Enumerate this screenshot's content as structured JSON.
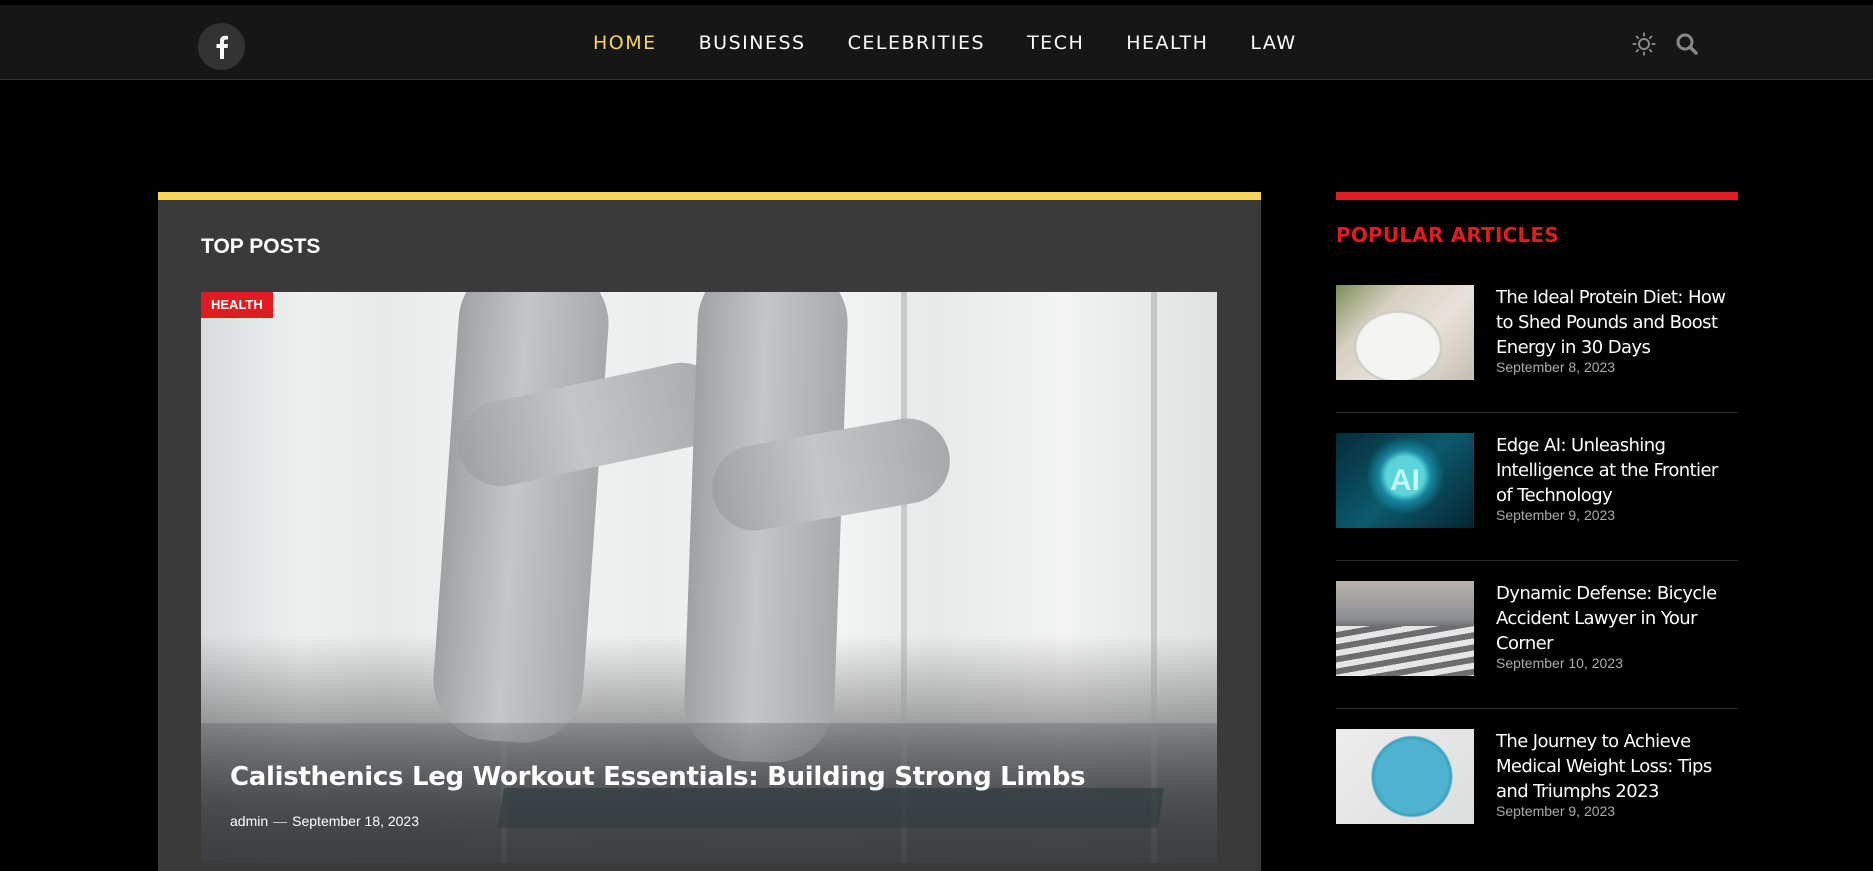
{
  "header": {
    "social": [
      {
        "name": "facebook",
        "icon": "facebook-icon"
      }
    ],
    "nav": [
      {
        "label": "HOME",
        "active": true
      },
      {
        "label": "BUSINESS",
        "active": false
      },
      {
        "label": "CELEBRITIES",
        "active": false
      },
      {
        "label": "TECH",
        "active": false
      },
      {
        "label": "HEALTH",
        "active": false
      },
      {
        "label": "LAW",
        "active": false
      }
    ],
    "icons": [
      "sun-icon",
      "search-icon"
    ]
  },
  "top_posts": {
    "title": "TOP POSTS",
    "accent_color": "#f7d55a",
    "featured": {
      "category": "HEALTH",
      "title": "Calisthenics Leg Workout Essentials: Building Strong Limbs",
      "author": "admin",
      "separator": "—",
      "date": "September 18, 2023"
    }
  },
  "popular": {
    "title": "POPULAR ARTICLES",
    "accent_color": "#e11b22",
    "articles": [
      {
        "title": "The Ideal Protein Diet: How to Shed Pounds and Boost Energy in 30 Days",
        "date": "September 8, 2023"
      },
      {
        "title": "Edge AI: Unleashing Intelligence at the Frontier of Technology",
        "date": "September 9, 2023"
      },
      {
        "title": "Dynamic Defense: Bicycle Accident Lawyer in Your Corner",
        "date": "September 10, 2023"
      },
      {
        "title": "The Journey to Achieve Medical Weight Loss: Tips and Triumphs 2023",
        "date": "September 9, 2023"
      }
    ]
  }
}
